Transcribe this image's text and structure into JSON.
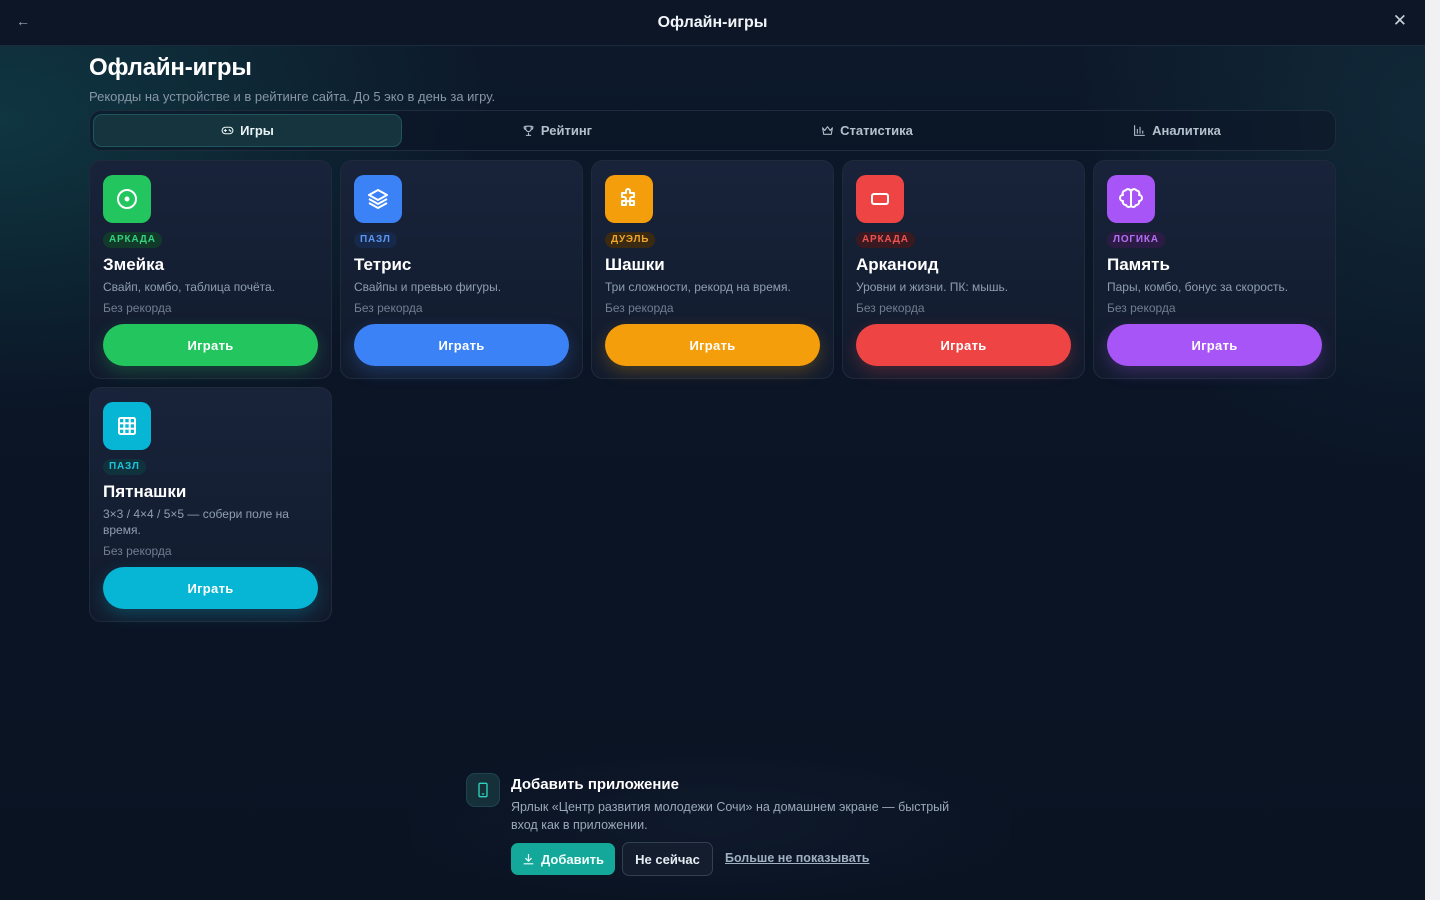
{
  "window": {
    "title": "Офлайн-игры",
    "back_icon": "arrow-left-icon",
    "close_icon": "close-icon"
  },
  "header": {
    "title": "Офлайн-игры",
    "subtitle": "Рекорды на устройстве и в рейтинге сайта. До 5 эко в день за игру."
  },
  "tabs": [
    {
      "label": "Игры",
      "icon": "gamepad-icon",
      "active": true
    },
    {
      "label": "Рейтинг",
      "icon": "trophy-icon",
      "active": false
    },
    {
      "label": "Статистика",
      "icon": "crown-icon",
      "active": false
    },
    {
      "label": "Аналитика",
      "icon": "bar-chart-icon",
      "active": false
    }
  ],
  "games": [
    {
      "tag": "АРКАДА",
      "name": "Змейка",
      "desc": "Свайп, комбо, таблица почёта.",
      "record": "Без рекорда",
      "play": "Играть",
      "icon": "target-icon",
      "color": "#22c55e",
      "tag_bg": "#123a2a",
      "tag_color": "#34d27a"
    },
    {
      "tag": "ПАЗЛ",
      "name": "Тетрис",
      "desc": "Свайпы и превью фигуры.",
      "record": "Без рекорда",
      "play": "Играть",
      "icon": "layers-icon",
      "color": "#3b82f6",
      "tag_bg": "#17294a",
      "tag_color": "#5b95f5"
    },
    {
      "tag": "ДУЭЛЬ",
      "name": "Шашки",
      "desc": "Три сложности, рекорд на время.",
      "record": "Без рекорда",
      "play": "Играть",
      "icon": "puzzle-icon",
      "color": "#f59e0b",
      "tag_bg": "#3a2a12",
      "tag_color": "#f0a52a"
    },
    {
      "tag": "АРКАДА",
      "name": "Арканоид",
      "desc": "Уровни и жизни. ПК: мышь.",
      "record": "Без рекорда",
      "play": "Играть",
      "icon": "rectangle-icon",
      "color": "#ef4444",
      "tag_bg": "#3a1a20",
      "tag_color": "#f05252"
    },
    {
      "tag": "ЛОГИКА",
      "name": "Память",
      "desc": "Пары, комбо, бонус за скорость.",
      "record": "Без рекорда",
      "play": "Играть",
      "icon": "brain-icon",
      "color": "#a855f7",
      "tag_bg": "#2c1c45",
      "tag_color": "#b36ef6"
    },
    {
      "tag": "ПАЗЛ",
      "name": "Пятнашки",
      "desc": "3×3 / 4×4 / 5×5 — собери поле на время.",
      "record": "Без рекорда",
      "play": "Играть",
      "icon": "grid-icon",
      "color": "#06b6d4",
      "tag_bg": "#10323c",
      "tag_color": "#1cc3dd"
    }
  ],
  "install_banner": {
    "icon": "smartphone-icon",
    "title": "Добавить приложение",
    "text": "Ярлык «Центр развития молодежи Сочи» на домашнем экране — быстрый вход как в приложении.",
    "add_label": "Добавить",
    "add_icon": "download-icon",
    "not_now_label": "Не сейчас",
    "hide_label": "Больше не показывать"
  }
}
